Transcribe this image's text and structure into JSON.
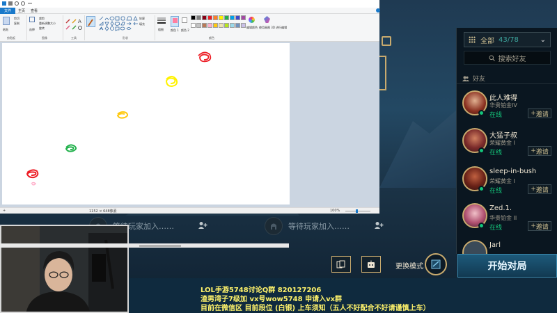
{
  "paint": {
    "menu": {
      "file": "文件",
      "tabs": [
        "主页",
        "查看"
      ]
    },
    "ribbon": {
      "clipboard": {
        "paste": "粘贴",
        "cut": "剪切",
        "copy": "复制",
        "label": "剪贴板"
      },
      "image": {
        "crop": "裁剪",
        "resize": "重新调整大小",
        "rotate": "旋转",
        "select": "选择",
        "label": "图像"
      },
      "tools": {
        "label": "工具"
      },
      "shapes": {
        "outline": "轮廓",
        "fill": "填充",
        "label": "形状"
      },
      "size": "粗细",
      "color1": "颜色 1",
      "color2": "颜色 2",
      "colors_label": "颜色",
      "edit_colors": "编辑颜色",
      "paint3d": "使用画图 3D 进行编辑"
    },
    "palette": [
      "#000000",
      "#7f7f7f",
      "#880015",
      "#ed1c24",
      "#ff7f27",
      "#fff200",
      "#22b14c",
      "#00a2e8",
      "#3f48cc",
      "#a349a4",
      "#ffffff",
      "#c3c3c3",
      "#b97a57",
      "#ffaec9",
      "#ffc90e",
      "#efe4b0",
      "#b5e61d",
      "#99d9ea",
      "#7092be",
      "#c8bfe7"
    ],
    "status": {
      "selection": "",
      "size": "1152 × 648像素",
      "zoom": "100%"
    }
  },
  "friends": {
    "filter": "全部",
    "count": "43/78",
    "search_placeholder": "搜索好友",
    "group_label": "好友",
    "list": [
      {
        "name": "此人难得",
        "rank": "华贵铂金IV",
        "status": "在线",
        "invite": "邀请"
      },
      {
        "name": "大猛子叔",
        "rank": "荣耀黄金 I",
        "status": "在线",
        "invite": "邀请"
      },
      {
        "name": "sleep-in-bush",
        "rank": "荣耀黄金 I",
        "status": "在线",
        "invite": "邀请"
      },
      {
        "name": "Zed.1.",
        "rank": "华贵铂金 II",
        "status": "在线",
        "invite": "邀请"
      },
      {
        "name": "Jarl",
        "rank": "",
        "status": "",
        "invite": ""
      }
    ]
  },
  "lobby": {
    "waiting_slot": "等待玩家加入……",
    "swap_mode": "更换模式",
    "start": "开始对局"
  },
  "stream_info": [
    "LOL手游5748讨论Q群 820127206",
    "渣男湾子7级加  vx号wow5748    申请入vx群",
    "目前在微信区  目前段位 (白银) 上车须知（五人不好配合不好请谨慎上车）"
  ]
}
